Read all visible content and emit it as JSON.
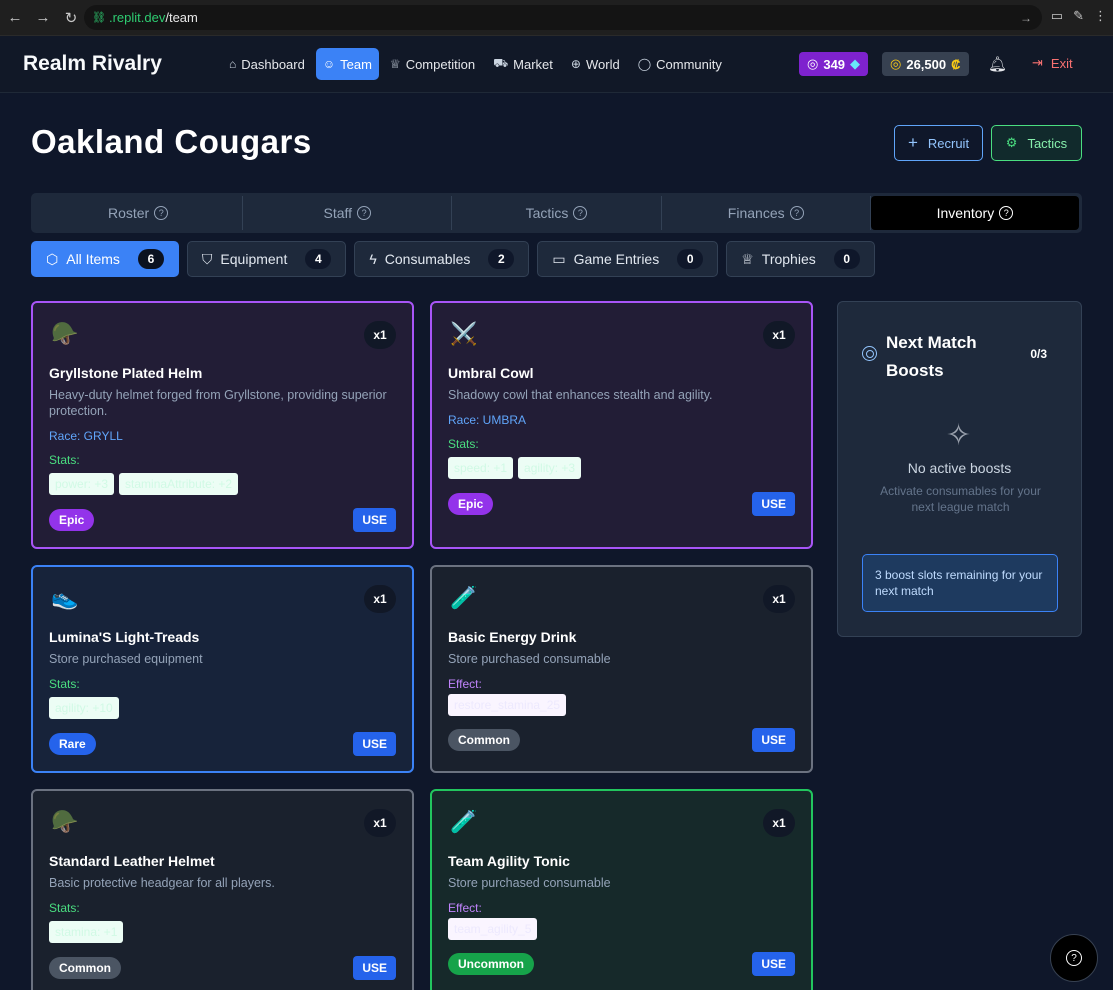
{
  "browser": {
    "url_domain": ".replit.dev",
    "url_path": "/team"
  },
  "header": {
    "brand": "Realm Rivalry",
    "nav": [
      {
        "label": "Dashboard",
        "icon": "home-icon"
      },
      {
        "label": "Team",
        "icon": "users-icon"
      },
      {
        "label": "Competition",
        "icon": "trophy-icon"
      },
      {
        "label": "Market",
        "icon": "cart-icon"
      },
      {
        "label": "World",
        "icon": "globe-icon"
      },
      {
        "label": "Community",
        "icon": "chat-icon"
      }
    ],
    "gems": "349",
    "credits": "26,500",
    "exit_label": "Exit"
  },
  "page": {
    "title": "Oakland Cougars",
    "recruit_label": "Recruit",
    "tactics_label": "Tactics"
  },
  "tabs": [
    "Roster",
    "Staff",
    "Tactics",
    "Finances",
    "Inventory"
  ],
  "active_tab": "Inventory",
  "filters": [
    {
      "label": "All Items",
      "count": "6"
    },
    {
      "label": "Equipment",
      "count": "4"
    },
    {
      "label": "Consumables",
      "count": "2"
    },
    {
      "label": "Game Entries",
      "count": "0"
    },
    {
      "label": "Trophies",
      "count": "0"
    }
  ],
  "items": [
    {
      "name": "Gryllstone Plated Helm",
      "desc": "Heavy-duty helmet forged from Gryllstone, providing superior protection.",
      "race": "Race: GRYLL",
      "section_label": "Stats:",
      "chips": [
        "power: +3",
        "staminaAttribute: +2"
      ],
      "rarity": "Epic",
      "qty": "x1",
      "use_label": "USE",
      "icon": "🪖"
    },
    {
      "name": "Umbral Cowl",
      "desc": "Shadowy cowl that enhances stealth and agility.",
      "race": "Race: UMBRA",
      "section_label": "Stats:",
      "chips": [
        "speed: +1",
        "agility: +3"
      ],
      "rarity": "Epic",
      "qty": "x1",
      "use_label": "USE",
      "icon": "⚔️"
    },
    {
      "name": "Lumina'S Light-Treads",
      "desc": "Store purchased equipment",
      "section_label": "Stats:",
      "chips": [
        "agility: +10"
      ],
      "rarity": "Rare",
      "qty": "x1",
      "use_label": "USE",
      "icon": "👟"
    },
    {
      "name": "Basic Energy Drink",
      "desc": "Store purchased consumable",
      "section_label": "Effect:",
      "chips": [
        "restore_stamina_25"
      ],
      "rarity": "Common",
      "qty": "x1",
      "use_label": "USE",
      "icon": "🧪"
    },
    {
      "name": "Standard Leather Helmet",
      "desc": "Basic protective headgear for all players.",
      "section_label": "Stats:",
      "chips": [
        "stamina: +1"
      ],
      "rarity": "Common",
      "qty": "x1",
      "use_label": "USE",
      "icon": "🪖"
    },
    {
      "name": "Team Agility Tonic",
      "desc": "Store purchased consumable",
      "section_label": "Effect:",
      "chips": [
        "team_agility_5"
      ],
      "rarity": "Uncommon",
      "qty": "x1",
      "use_label": "USE",
      "icon": "🧪"
    }
  ],
  "boosts": {
    "title": "Next Match Boosts",
    "count": "0/3",
    "empty_title": "No active boosts",
    "empty_sub": "Activate consumables for your next league match",
    "slots_text": "3 boost slots remaining for your next match"
  }
}
